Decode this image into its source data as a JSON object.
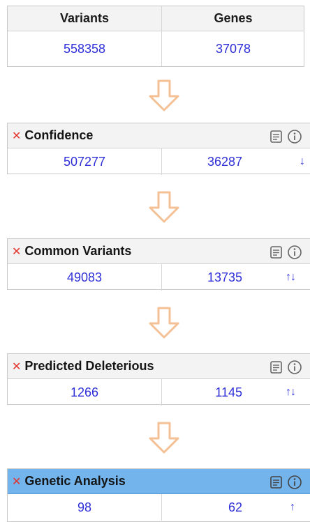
{
  "summary": {
    "col_variants": "Variants",
    "col_genes": "Genes",
    "variants": "558358",
    "genes": "37078"
  },
  "filters": [
    {
      "title": "Confidence",
      "variants": "507277",
      "genes": "36287",
      "arrows": "↓",
      "active": false
    },
    {
      "title": "Common Variants",
      "variants": "49083",
      "genes": "13735",
      "arrows": "↑↓",
      "active": false
    },
    {
      "title": "Predicted Deleterious",
      "variants": "1266",
      "genes": "1145",
      "arrows": "↑↓",
      "active": false
    },
    {
      "title": "Genetic Analysis",
      "variants": "98",
      "genes": "62",
      "arrows": "↑",
      "active": true
    }
  ],
  "icons": {
    "remove": "remove-x-icon",
    "notes": "notes-icon",
    "info": "info-icon",
    "flow": "down-arrow-icon"
  },
  "colors": {
    "count_text": "#2f2fd8",
    "remove_x": "#e0322a",
    "active_header": "#73b4ec",
    "flow_arrow": "#f4c197"
  }
}
